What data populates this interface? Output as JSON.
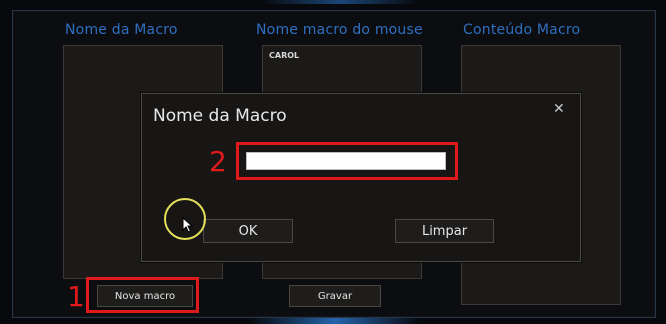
{
  "columns": {
    "macro_name": "Nome da Macro",
    "mouse_macro_name": "Nome macro do mouse",
    "macro_content": "Conteúdo Macro"
  },
  "mouse_macros": [
    "CAROL"
  ],
  "buttons": {
    "new_macro": "Nova macro",
    "save": "Gravar"
  },
  "dialog": {
    "title": "Nome da Macro",
    "close_symbol": "✕",
    "name_value": "",
    "ok": "OK",
    "clear": "Limpar"
  },
  "annotations": {
    "step1": "1",
    "step2": "2"
  },
  "colors": {
    "title_blue": "#2f6fbf",
    "highlight_red": "#e0191b",
    "cursor_ring": "#e3df58"
  }
}
